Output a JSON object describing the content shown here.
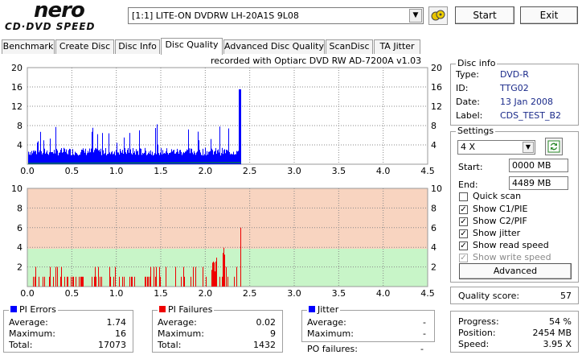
{
  "logo": {
    "main": "nero",
    "sub": "CD·DVD SPEED"
  },
  "drive": {
    "selected": "[1:1]  LITE-ON DVDRW LH-20A1S 9L08"
  },
  "toolbar": {
    "start": "Start",
    "exit": "Exit"
  },
  "tabs": [
    {
      "label": "Benchmark"
    },
    {
      "label": "Create Disc"
    },
    {
      "label": "Disc Info"
    },
    {
      "label": "Disc Quality",
      "active": true
    },
    {
      "label": "Advanced Disc Quality"
    },
    {
      "label": "ScanDisc"
    },
    {
      "label": "TA Jitter"
    }
  ],
  "recorded_with": "recorded with Optiarc DVD RW AD-7200A  v1.03",
  "chart_data": [
    {
      "type": "bar",
      "name": "pi_errors_chart",
      "x_ticks": [
        "0.0",
        "0.5",
        "1.0",
        "1.5",
        "2.0",
        "2.5",
        "3.0",
        "3.5",
        "4.0",
        "4.5"
      ],
      "y_ticks": [
        "4",
        "8",
        "12",
        "16",
        "20"
      ],
      "xlim": [
        0,
        4.5
      ],
      "ylim": [
        0,
        20
      ],
      "colors": {
        "bars": "#0000ff",
        "read_speed": "#00aa00"
      },
      "data_extent_gb": 2.4
    },
    {
      "type": "bar",
      "name": "pi_failures_chart",
      "x_ticks": [
        "0.0",
        "0.5",
        "1.0",
        "1.5",
        "2.0",
        "2.5",
        "3.0",
        "3.5",
        "4.0",
        "4.5"
      ],
      "y_ticks": [
        "2",
        "4",
        "6",
        "8",
        "10"
      ],
      "xlim": [
        0,
        4.5
      ],
      "ylim": [
        0,
        10
      ],
      "colors": {
        "bars": "#ee0000",
        "ok_zone": "#c8f5c8",
        "warn_zone": "#f8d4c0"
      },
      "ok_threshold": 4,
      "data_extent_gb": 2.4
    }
  ],
  "disc_info": {
    "title": "Disc info",
    "type_label": "Type:",
    "type": "DVD-R",
    "id_label": "ID:",
    "id": "TTG02",
    "date_label": "Date:",
    "date": "13 Jan 2008",
    "label_label": "Label:",
    "label": "CDS_TEST_B2"
  },
  "settings": {
    "title": "Settings",
    "speed": "4 X",
    "start_label": "Start:",
    "start": "0000 MB",
    "end_label": "End:",
    "end": "4489 MB",
    "quick_scan": "Quick scan",
    "show_c1": "Show C1/PIE",
    "show_c2": "Show C2/PIF",
    "show_jitter": "Show jitter",
    "show_read": "Show read speed",
    "show_write": "Show write speed",
    "advanced": "Advanced"
  },
  "quality": {
    "label": "Quality score:",
    "value": "57"
  },
  "progress": {
    "progress_label": "Progress:",
    "progress": "54 %",
    "position_label": "Position:",
    "position": "2454 MB",
    "speed_label": "Speed:",
    "speed": "3.95 X"
  },
  "pi_errors": {
    "title": "PI Errors",
    "color": "#0000ff",
    "avg_label": "Average:",
    "avg": "1.74",
    "max_label": "Maximum:",
    "max": "16",
    "total_label": "Total:",
    "total": "17073"
  },
  "pi_failures": {
    "title": "PI Failures",
    "color": "#ee0000",
    "avg_label": "Average:",
    "avg": "0.02",
    "max_label": "Maximum:",
    "max": "9",
    "total_label": "Total:",
    "total": "1432"
  },
  "jitter": {
    "title": "Jitter",
    "color": "#0000ff",
    "avg_label": "Average:",
    "avg": "-",
    "max_label": "Maximum:",
    "max": "-",
    "po_label": "PO failures:",
    "po": "-"
  }
}
